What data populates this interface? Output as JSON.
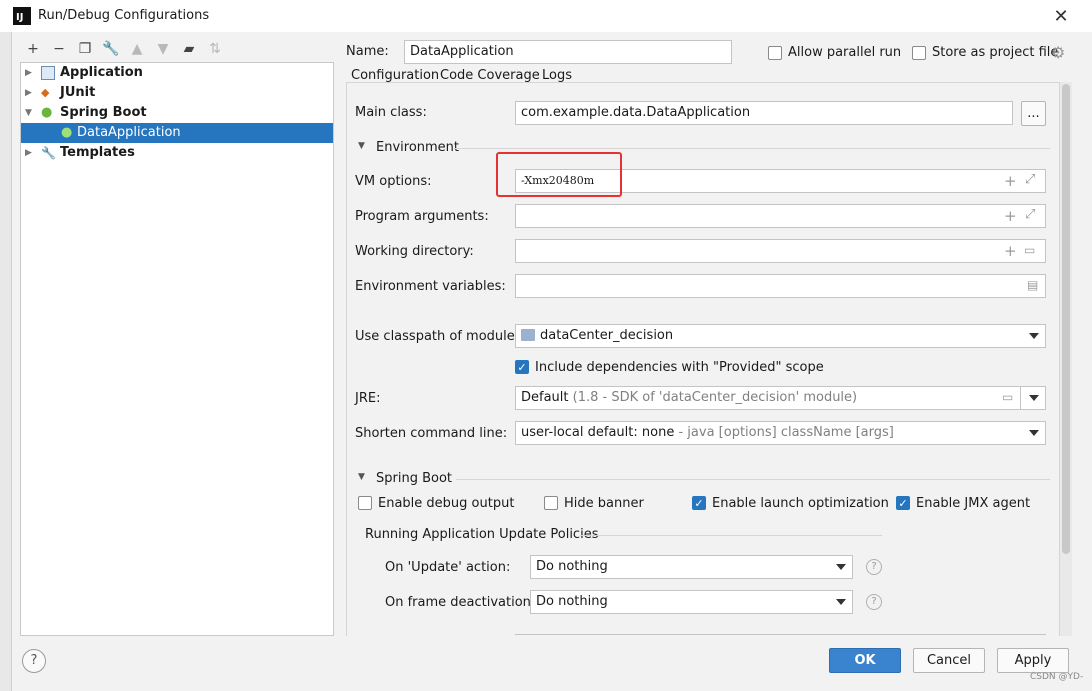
{
  "window": {
    "title": "Run/Debug Configurations",
    "app_icon_text": "IJ"
  },
  "toolbar": {
    "icons": [
      "add-icon",
      "remove-icon",
      "copy-icon",
      "wrench-icon",
      "move-up-icon",
      "move-down-icon",
      "new-folder-icon",
      "sort-icon"
    ]
  },
  "tree": {
    "items": [
      {
        "label": "Application",
        "bold": true
      },
      {
        "label": "JUnit",
        "bold": true
      },
      {
        "label": "Spring Boot",
        "bold": true
      },
      {
        "label": "DataApplication",
        "selected": true
      },
      {
        "label": "Templates",
        "bold": true
      }
    ]
  },
  "header": {
    "name_label": "Name:",
    "name_value": "DataApplication",
    "allow_parallel_label": "Allow parallel run",
    "allow_parallel_checked": false,
    "store_project_label": "Store as project file",
    "store_project_checked": false
  },
  "tabs": [
    "Configuration",
    "Code Coverage",
    "Logs"
  ],
  "form": {
    "main_class_label": "Main class:",
    "main_class_value": "com.example.data.DataApplication",
    "browse_label": "...",
    "environment_section": "Environment",
    "vm_options_label": "VM options:",
    "vm_options_value": "-Xmx20480m",
    "program_args_label": "Program arguments:",
    "working_dir_label": "Working directory:",
    "env_vars_label": "Environment variables:",
    "classpath_label": "Use classpath of module:",
    "classpath_value": "dataCenter_decision",
    "include_deps_label": "Include dependencies with \"Provided\" scope",
    "include_deps_checked": true,
    "jre_label": "JRE:",
    "jre_value": "Default",
    "jre_detail": "(1.8 - SDK of 'dataCenter_decision' module)",
    "shorten_label": "Shorten command line:",
    "shorten_value": "user-local default: none",
    "shorten_detail": "- java [options] className [args]"
  },
  "spring_boot": {
    "section": "Spring Boot",
    "debug_output_label": "Enable debug output",
    "debug_output_checked": false,
    "hide_banner_label": "Hide banner",
    "hide_banner_checked": false,
    "launch_opt_label": "Enable launch optimization",
    "launch_opt_checked": true,
    "jmx_label": "Enable JMX agent",
    "jmx_checked": true,
    "update_policies_title": "Running Application Update Policies",
    "on_update_label": "On 'Update' action:",
    "on_update_value": "Do nothing",
    "on_frame_label": "On frame deactivation:",
    "on_frame_value": "Do nothing"
  },
  "footer": {
    "help_label": "?",
    "ok_label": "OK",
    "cancel_label": "Cancel",
    "apply_label": "Apply"
  },
  "watermark": "CSDN @YD-",
  "colors": {
    "accent": "#2675bf",
    "highlight_box": "#e53333"
  }
}
